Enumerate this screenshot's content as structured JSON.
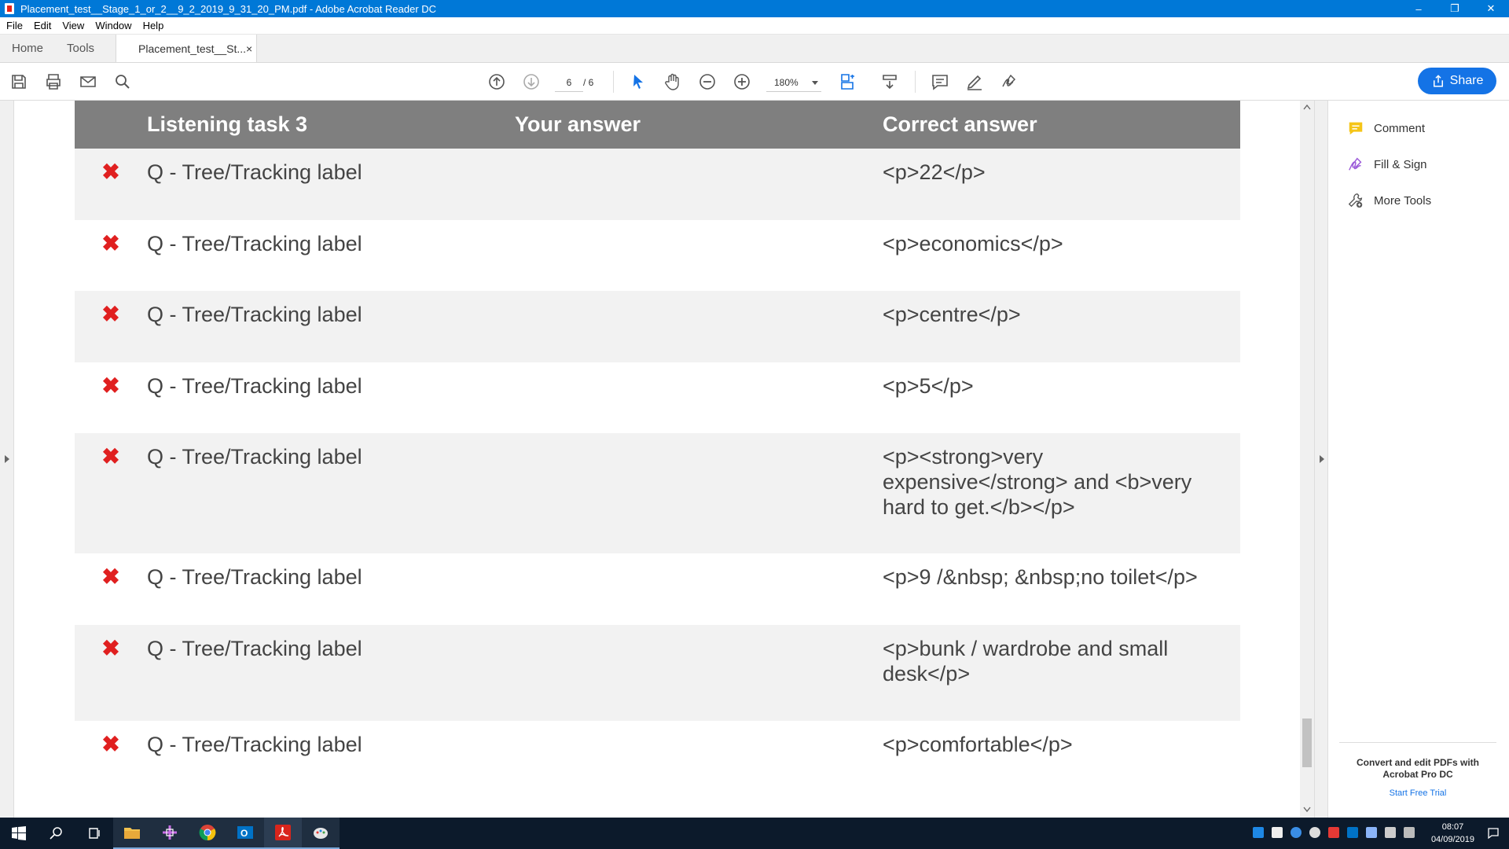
{
  "window": {
    "title": "Placement_test__Stage_1_or_2__9_2_2019_9_31_20_PM.pdf - Adobe Acrobat Reader DC",
    "minimize": "–",
    "restore": "❐",
    "close": "✕"
  },
  "menu": [
    "File",
    "Edit",
    "View",
    "Window",
    "Help"
  ],
  "tabs": {
    "home": "Home",
    "tools": "Tools",
    "document": "Placement_test__St...",
    "close": "×"
  },
  "toolbar": {
    "page_current": "6",
    "page_total": "/ 6",
    "zoom": "180%",
    "share_label": "Share"
  },
  "right_panel": {
    "items": [
      "Comment",
      "Fill & Sign",
      "More Tools"
    ],
    "promo_title": "Convert and edit PDFs with Acrobat Pro DC",
    "promo_link": "Start Free Trial"
  },
  "table": {
    "headers": [
      "Listening task 3",
      "Your answer",
      "Correct answer"
    ],
    "mark": "✖",
    "rows": [
      {
        "question": "Q - Tree/Tracking label",
        "your_answer": "",
        "correct": "<p>22</p>"
      },
      {
        "question": "Q - Tree/Tracking label",
        "your_answer": "",
        "correct": "<p>economics</p>"
      },
      {
        "question": "Q - Tree/Tracking label",
        "your_answer": "",
        "correct": "<p>centre</p>"
      },
      {
        "question": "Q - Tree/Tracking label",
        "your_answer": "",
        "correct": "<p>5</p>"
      },
      {
        "question": "Q - Tree/Tracking label",
        "your_answer": "",
        "correct": "<p><strong>very expensive</strong> and <b>very hard to get.</b></p>"
      },
      {
        "question": "Q - Tree/Tracking label",
        "your_answer": "",
        "correct": "<p>9 /&nbsp; &nbsp;no toilet</p>"
      },
      {
        "question": "Q - Tree/Tracking label",
        "your_answer": "",
        "correct": "<p>bunk / wardrobe and small desk</p>"
      },
      {
        "question": "Q - Tree/Tracking label",
        "your_answer": "",
        "correct": "<p>comfortable</p>"
      }
    ]
  },
  "taskbar": {
    "time": "08:07",
    "date": "04/09/2019"
  },
  "colors": {
    "titlebar": "#0078d7",
    "accent": "#1473e6",
    "wrong_mark": "#e02020",
    "table_header": "#7f7f7f"
  }
}
